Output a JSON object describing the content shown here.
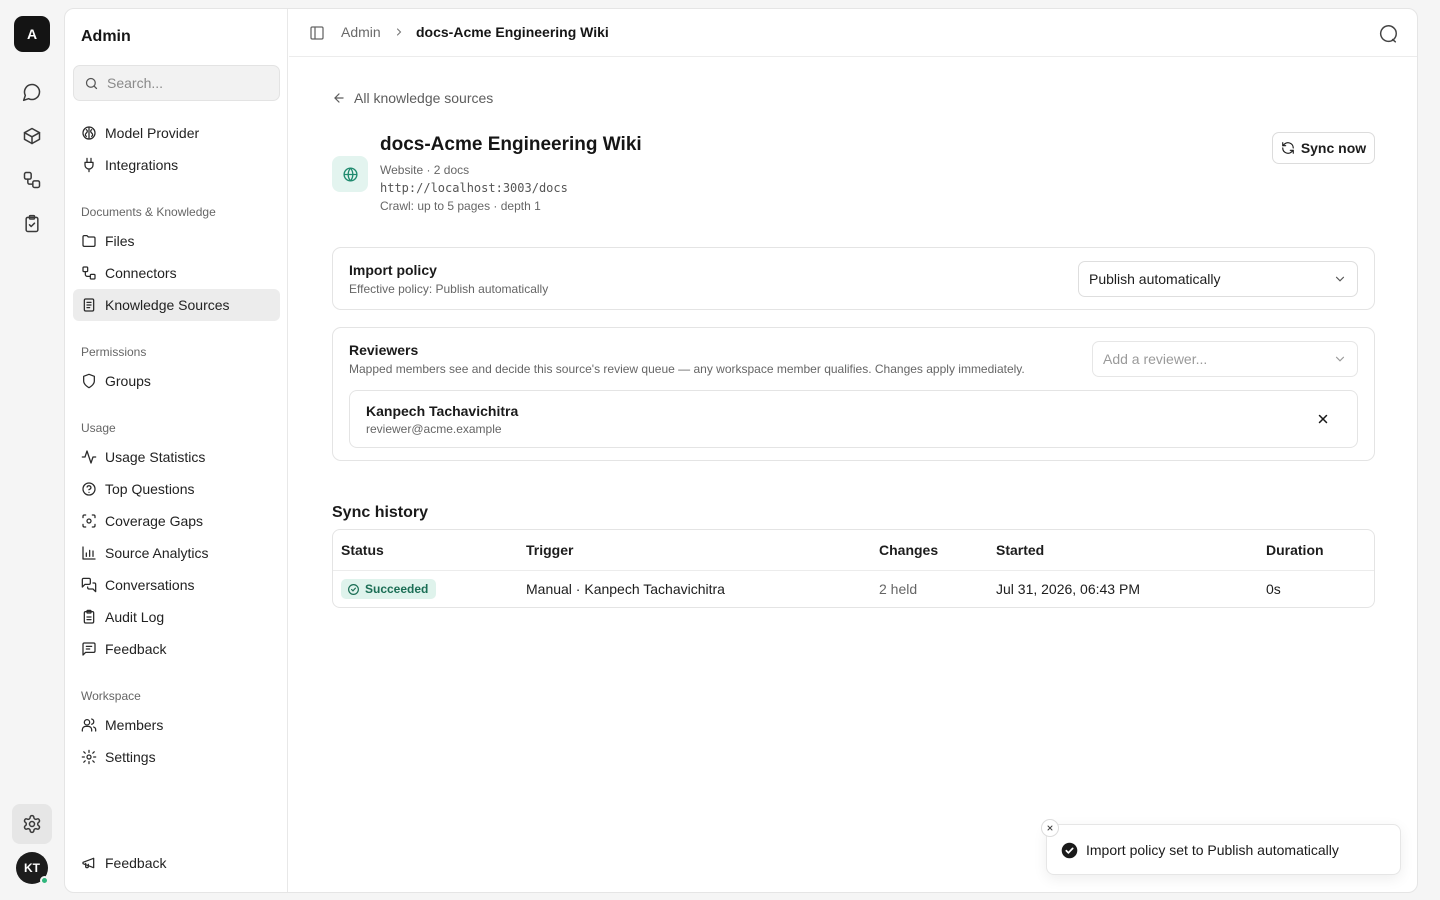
{
  "rail": {
    "logo": "A",
    "icons": [
      "chat-icon",
      "cube-icon",
      "workflow-icon",
      "clipboard-check-icon",
      "gear-icon"
    ],
    "avatar_initials": "KT"
  },
  "sidebar": {
    "title": "Admin",
    "search_placeholder": "Search...",
    "top_items": [
      {
        "label": "Model Provider",
        "icon": "brain-icon"
      },
      {
        "label": "Integrations",
        "icon": "plug-icon"
      }
    ],
    "sections": [
      {
        "label": "Documents & Knowledge",
        "items": [
          {
            "label": "Files",
            "icon": "folder-icon"
          },
          {
            "label": "Connectors",
            "icon": "connector-icon"
          },
          {
            "label": "Knowledge Sources",
            "icon": "book-icon",
            "active": true
          }
        ]
      },
      {
        "label": "Permissions",
        "items": [
          {
            "label": "Groups",
            "icon": "shield-icon"
          }
        ]
      },
      {
        "label": "Usage",
        "items": [
          {
            "label": "Usage Statistics",
            "icon": "activity-icon"
          },
          {
            "label": "Top Questions",
            "icon": "help-circle-icon"
          },
          {
            "label": "Coverage Gaps",
            "icon": "scan-icon"
          },
          {
            "label": "Source Analytics",
            "icon": "bar-chart-icon"
          },
          {
            "label": "Conversations",
            "icon": "messages-icon"
          },
          {
            "label": "Audit Log",
            "icon": "clipboard-icon"
          },
          {
            "label": "Feedback",
            "icon": "message-square-text-icon"
          }
        ]
      },
      {
        "label": "Workspace",
        "items": [
          {
            "label": "Members",
            "icon": "users-icon"
          },
          {
            "label": "Settings",
            "icon": "settings-icon"
          }
        ]
      }
    ],
    "footer_item": {
      "label": "Feedback",
      "icon": "megaphone-icon"
    }
  },
  "topbar": {
    "crumb_root": "Admin",
    "crumb_current": "docs-Acme Engineering Wiki"
  },
  "content": {
    "back_label": "All knowledge sources",
    "source": {
      "title": "docs-Acme Engineering Wiki",
      "meta": "Website · 2 docs",
      "url": "http://localhost:3003/docs",
      "crawl": "Crawl: up to 5 pages · depth 1"
    },
    "sync_button": "Sync now",
    "import_policy": {
      "title": "Import policy",
      "subtitle": "Effective policy: Publish automatically",
      "selected": "Publish automatically"
    },
    "reviewers": {
      "title": "Reviewers",
      "subtitle": "Mapped members see and decide this source's review queue — any workspace member qualifies. Changes apply immediately.",
      "add_placeholder": "Add a reviewer...",
      "list": [
        {
          "name": "Kanpech Tachavichitra",
          "email": "reviewer@acme.example"
        }
      ]
    },
    "sync_history": {
      "title": "Sync history",
      "columns": [
        "Status",
        "Trigger",
        "Changes",
        "Started",
        "Duration"
      ],
      "rows": [
        {
          "status": "Succeeded",
          "trigger": "Manual · Kanpech Tachavichitra",
          "changes": "2 held",
          "started": "Jul 31, 2026, 06:43 PM",
          "duration": "0s"
        }
      ]
    }
  },
  "toast": {
    "message": "Import policy set to Publish automatically"
  },
  "colors": {
    "accent_green": "#1f8a6e",
    "badge_bg": "#dff3ec",
    "dark": "#141414"
  }
}
